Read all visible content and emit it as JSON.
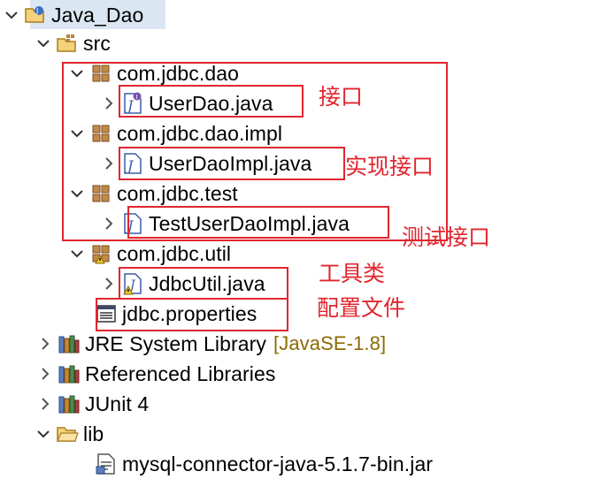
{
  "tree": {
    "project": {
      "label": "Java_Dao",
      "icon": "java-project-icon",
      "expanded": true
    },
    "src": {
      "label": "src",
      "icon": "source-folder-icon",
      "expanded": true
    },
    "pkg_dao": {
      "label": "com.jdbc.dao",
      "icon": "package-icon",
      "expanded": true
    },
    "file_userdao": {
      "label": "UserDao.java",
      "icon": "java-interface-icon"
    },
    "pkg_dao_impl": {
      "label": "com.jdbc.dao.impl",
      "icon": "package-icon",
      "expanded": true
    },
    "file_userdaoimpl": {
      "label": "UserDaoImpl.java",
      "icon": "java-file-icon"
    },
    "pkg_test": {
      "label": "com.jdbc.test",
      "icon": "package-icon",
      "expanded": true
    },
    "file_testuserdaoimpl": {
      "label": "TestUserDaoImpl.java",
      "icon": "java-file-icon"
    },
    "pkg_util": {
      "label": "com.jdbc.util",
      "icon": "package-warning-icon",
      "expanded": true
    },
    "file_jdbcutil": {
      "label": "JdbcUtil.java",
      "icon": "java-file-warning-icon"
    },
    "file_properties": {
      "label": "jdbc.properties",
      "icon": "properties-file-icon"
    },
    "jre": {
      "label": "JRE System Library",
      "decoration": "[JavaSE-1.8]",
      "icon": "library-icon",
      "expanded": false
    },
    "reflibs": {
      "label": "Referenced Libraries",
      "icon": "library-icon",
      "expanded": false
    },
    "junit": {
      "label": "JUnit 4",
      "icon": "library-icon",
      "expanded": false
    },
    "lib": {
      "label": "lib",
      "icon": "folder-icon",
      "expanded": true
    },
    "jar": {
      "label": "mysql-connector-java-5.1.7-bin.jar",
      "icon": "jar-file-icon"
    }
  },
  "annotations": {
    "interface": "接口",
    "implement": "实现接口",
    "test": "测试接口",
    "tool": "工具类",
    "config": "配置文件"
  },
  "colors": {
    "annotation": "#e0262e",
    "selection": "#dbe6f3",
    "decoration": "#8a6a00"
  }
}
